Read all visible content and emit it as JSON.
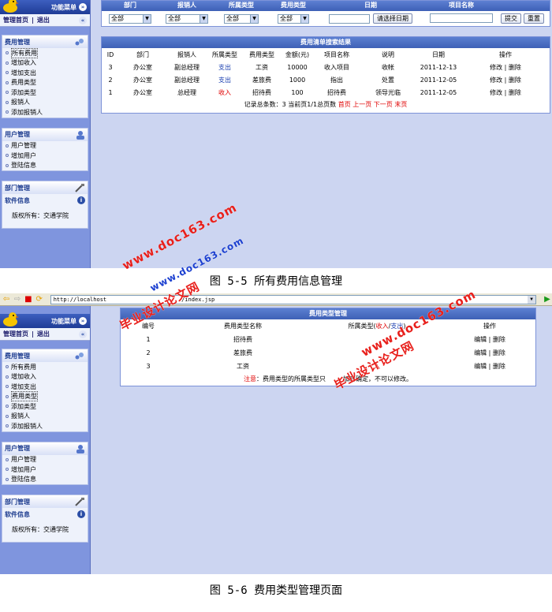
{
  "sidebar": {
    "menu_title": "功能菜单",
    "top_link_home": "管理首页",
    "top_link_sep": "|",
    "top_link_logout": "退出",
    "sections": {
      "cost": {
        "title": "费用管理",
        "items": [
          "所有费用",
          "增加收入",
          "增加支出",
          "费用类型",
          "添加类型",
          "报销人",
          "添加报销人"
        ]
      },
      "user": {
        "title": "用户管理",
        "items": [
          "用户管理",
          "增加用户",
          "登陆信息"
        ]
      },
      "dept": {
        "title": "部门管理"
      },
      "software": {
        "title": "软件信息"
      },
      "copyright": "版权所有：交通学院"
    }
  },
  "screen1": {
    "filter": {
      "headers": [
        "部门",
        "报销人",
        "所属类型",
        "费用类型",
        "日期",
        "项目名称"
      ],
      "selects": [
        "全部",
        "全部",
        "全部",
        "全部"
      ],
      "date_button": "请选择日期",
      "submit": "提交",
      "reset": "重置"
    },
    "results": {
      "title": "费用清单搜索结果",
      "columns": [
        "ID",
        "部门",
        "报销人",
        "所属类型",
        "费用类型",
        "金额(元)",
        "项目名称",
        "说明",
        "日期",
        "操作"
      ],
      "rows": [
        {
          "id": "3",
          "dept": "办公室",
          "person": "副总经理",
          "kind": "支出",
          "cost_type": "工资",
          "amount": "10000",
          "project": "收入项目",
          "desc": "收帐",
          "date": "2011-12-13",
          "edit": "修改",
          "sep": "|",
          "del": "删除"
        },
        {
          "id": "2",
          "dept": "办公室",
          "person": "副总经理",
          "kind": "支出",
          "cost_type": "差旅费",
          "amount": "1000",
          "project": "指出",
          "desc": "处置",
          "date": "2011-12-05",
          "edit": "修改",
          "sep": "|",
          "del": "删除"
        },
        {
          "id": "1",
          "dept": "办公室",
          "person": "总经理",
          "kind": "收入",
          "cost_type": "招待费",
          "amount": "100",
          "project": "招待费",
          "desc": "领导光临",
          "date": "2011-12-05",
          "edit": "修改",
          "sep": "|",
          "del": "删除"
        }
      ],
      "pager_text": "记录总条数：3 当前页1/1总页数",
      "pager_links": [
        "首页",
        "上一页",
        "下一页",
        "末页"
      ]
    },
    "caption": "图 5-5  所有费用信息管理"
  },
  "browser": {
    "address_start": "http://localhost",
    "address_end": "/index.jsp"
  },
  "screen2": {
    "title": "费用类型管理",
    "columns": {
      "no": "编号",
      "name": "费用类型名称",
      "belong": "所属类型",
      "belong_income": "收入",
      "belong_expense": "支出",
      "op": "操作"
    },
    "rows": [
      {
        "no": "1",
        "name": "招待费",
        "kind": "",
        "edit": "编辑",
        "sep": "|",
        "del": "删除"
      },
      {
        "no": "2",
        "name": "差旅费",
        "kind": "",
        "edit": "编辑",
        "sep": "|",
        "del": "删除"
      },
      {
        "no": "3",
        "name": "工资",
        "kind": "入",
        "edit": "编辑",
        "sep": "|",
        "del": "删除"
      }
    ],
    "note_label": "注意",
    "note_text": "：费用类型的所属类型只",
    "note_text2": "加时确定，不可以修改。",
    "caption": "图 5-6  费用类型管理页面"
  },
  "watermarks": {
    "site": "www.doc163.com",
    "cn": "毕业设计论文网"
  },
  "colors": {
    "sidebar": "#7f95de",
    "content_bg": "#ccd5f1",
    "header_blue": "#3e61b6",
    "watermark_red": "#e8201c",
    "link_red": "#e00000"
  }
}
